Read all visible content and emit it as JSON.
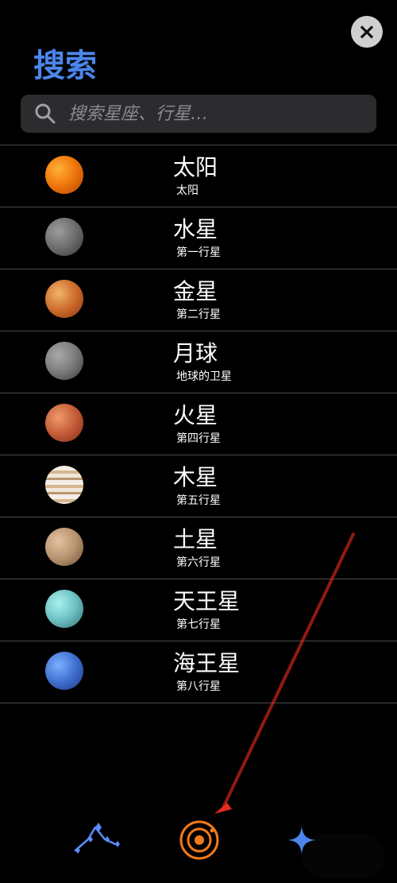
{
  "header": {
    "title": "搜索"
  },
  "search": {
    "placeholder": "搜索星座、行星…",
    "value": ""
  },
  "items": [
    {
      "name": "太阳",
      "subtitle": "太阳"
    },
    {
      "name": "水星",
      "subtitle": "第一行星"
    },
    {
      "name": "金星",
      "subtitle": "第二行星"
    },
    {
      "name": "月球",
      "subtitle": "地球的卫星"
    },
    {
      "name": "火星",
      "subtitle": "第四行星"
    },
    {
      "name": "木星",
      "subtitle": "第五行星"
    },
    {
      "name": "土星",
      "subtitle": "第六行星"
    },
    {
      "name": "天王星",
      "subtitle": "第七行星"
    },
    {
      "name": "海王星",
      "subtitle": "第八行星"
    }
  ],
  "icons": {
    "close": "close-icon",
    "search": "search-icon",
    "bottom_left": "constellation-icon",
    "bottom_middle": "solar-system-icon",
    "bottom_right": "sparkle-icon"
  },
  "colors": {
    "accent_blue": "#4b86ea",
    "accent_orange": "#f07a1a",
    "arrow_red": "#e52a1f"
  }
}
